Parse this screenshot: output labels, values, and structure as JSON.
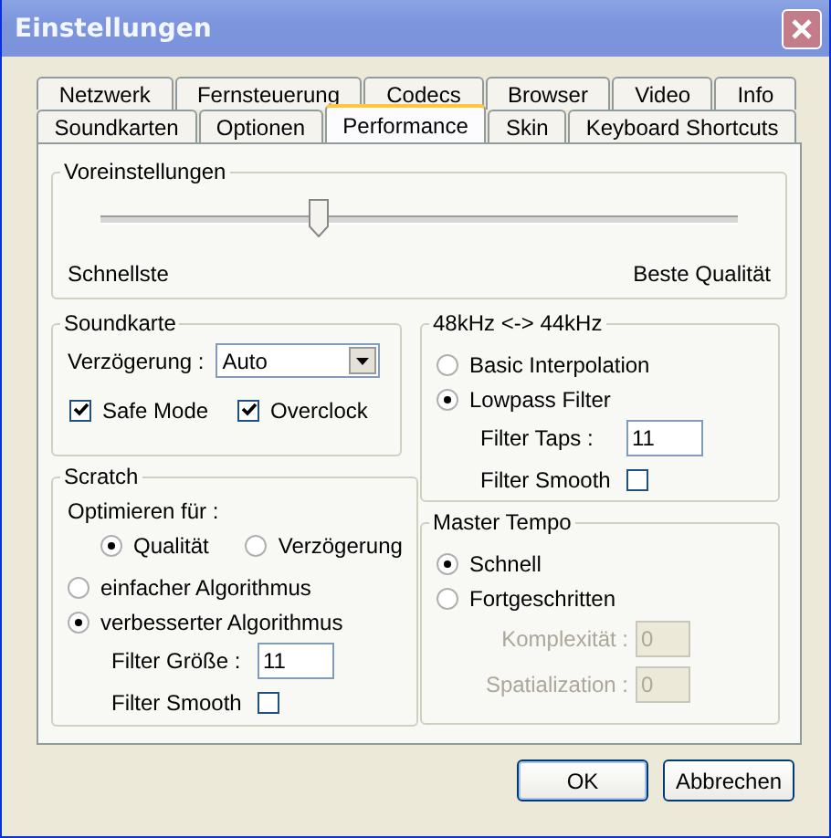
{
  "window": {
    "title": "Einstellungen"
  },
  "tab_rows": [
    [
      {
        "label": "Netzwerk",
        "selected": false
      },
      {
        "label": "Fernsteuerung",
        "selected": false
      },
      {
        "label": "Codecs",
        "selected": false
      },
      {
        "label": "Browser",
        "selected": false
      },
      {
        "label": "Video",
        "selected": false
      },
      {
        "label": "Info",
        "selected": false
      }
    ],
    [
      {
        "label": "Soundkarten",
        "selected": false
      },
      {
        "label": "Optionen",
        "selected": false
      },
      {
        "label": "Performance",
        "selected": true
      },
      {
        "label": "Skin",
        "selected": false
      },
      {
        "label": "Keyboard Shortcuts",
        "selected": false
      }
    ]
  ],
  "presets": {
    "title": "Voreinstellungen",
    "level": 0.34,
    "min_label": "Schnellste",
    "max_label": "Beste Qualität"
  },
  "soundcard": {
    "title": "Soundkarte",
    "delay_label": "Verzögerung :",
    "delay_value": "Auto",
    "checkboxes": [
      {
        "label": "Safe Mode",
        "checked": true
      },
      {
        "label": "Overclock",
        "checked": true
      }
    ]
  },
  "scratch": {
    "title": "Scratch",
    "optimize_label": "Optimieren für :",
    "optimize": [
      {
        "label": "Qualität",
        "selected": true
      },
      {
        "label": "Verzögerung",
        "selected": false
      }
    ],
    "algorithms": [
      {
        "label": "einfacher Algorithmus",
        "selected": false
      },
      {
        "label": "verbesserter Algorithmus",
        "selected": true
      }
    ],
    "filter_size_label": "Filter Größe :",
    "filter_size": "11",
    "smooth_label": "Filter Smooth",
    "smooth_checked": false
  },
  "resample": {
    "title": "48kHz <-> 44kHz",
    "options": [
      {
        "label": "Basic Interpolation",
        "selected": false
      },
      {
        "label": "Lowpass Filter",
        "selected": true
      }
    ],
    "taps_label": "Filter Taps :",
    "taps": "11",
    "smooth_label": "Filter Smooth",
    "smooth_checked": false
  },
  "master_tempo": {
    "title": "Master Tempo",
    "options": [
      {
        "label": "Schnell",
        "selected": true
      },
      {
        "label": "Fortgeschritten",
        "selected": false
      }
    ],
    "fields": [
      {
        "label": "Komplexität :",
        "value": "0",
        "disabled": true
      },
      {
        "label": "Spatialization :",
        "value": "0",
        "disabled": true
      }
    ]
  },
  "buttons": [
    {
      "label": "OK",
      "selected": true
    },
    {
      "label": "Abbrechen",
      "selected": false
    }
  ]
}
